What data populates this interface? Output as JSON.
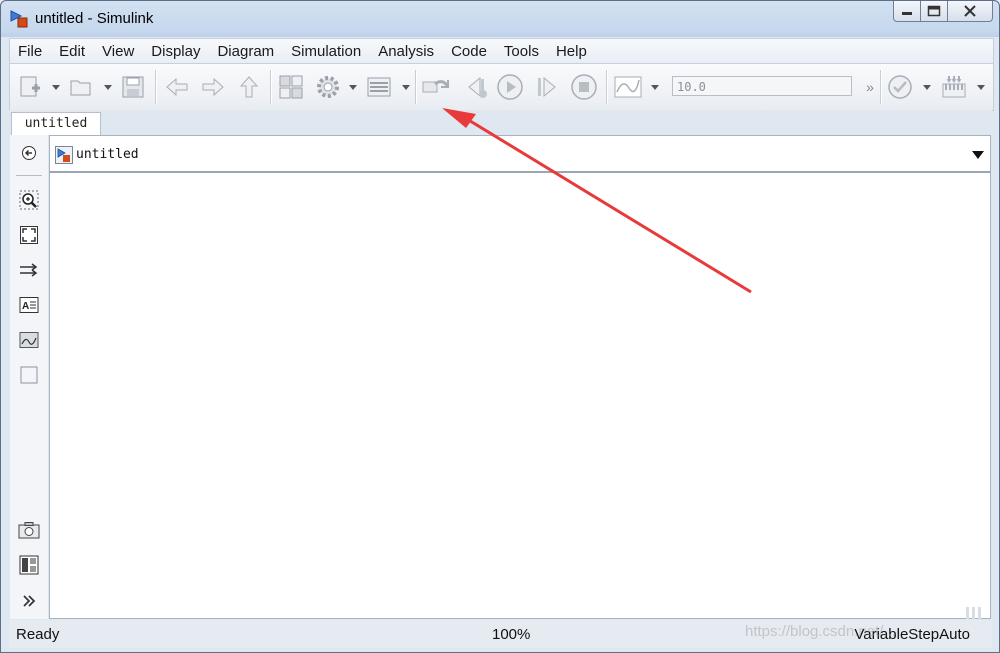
{
  "window": {
    "title": "untitled - Simulink"
  },
  "menu": [
    "File",
    "Edit",
    "View",
    "Display",
    "Diagram",
    "Simulation",
    "Analysis",
    "Code",
    "Tools",
    "Help"
  ],
  "toolbar": {
    "stop_time": "10.0",
    "more": "»"
  },
  "tab": {
    "label": "untitled"
  },
  "address": {
    "path": "untitled"
  },
  "status": {
    "ready": "Ready",
    "zoom": "100%",
    "solver": "VariableStepAuto"
  },
  "watermark": "https://blog.csdn.net/...",
  "colors": {
    "annotation_arrow": "#e83a3a",
    "title_bar": "#c6d8ee"
  },
  "icons": {
    "toolbar": [
      "new-model-icon",
      "open-icon",
      "save-icon",
      "back-arrow-icon",
      "forward-arrow-icon",
      "up-arrow-icon",
      "library-browser-icon",
      "model-config-gear-icon",
      "model-explorer-icon",
      "update-diagram-icon",
      "step-back-icon",
      "run-icon",
      "step-forward-icon",
      "stop-icon",
      "data-inspector-icon",
      "model-advisor-icon",
      "build-icon"
    ],
    "palette": [
      "navigate-back-icon",
      "zoom-icon",
      "fit-to-view-icon",
      "signal-icon",
      "annotation-icon",
      "image-icon",
      "area-icon",
      "screenshot-icon",
      "property-inspector-icon",
      "expand-icon"
    ]
  }
}
